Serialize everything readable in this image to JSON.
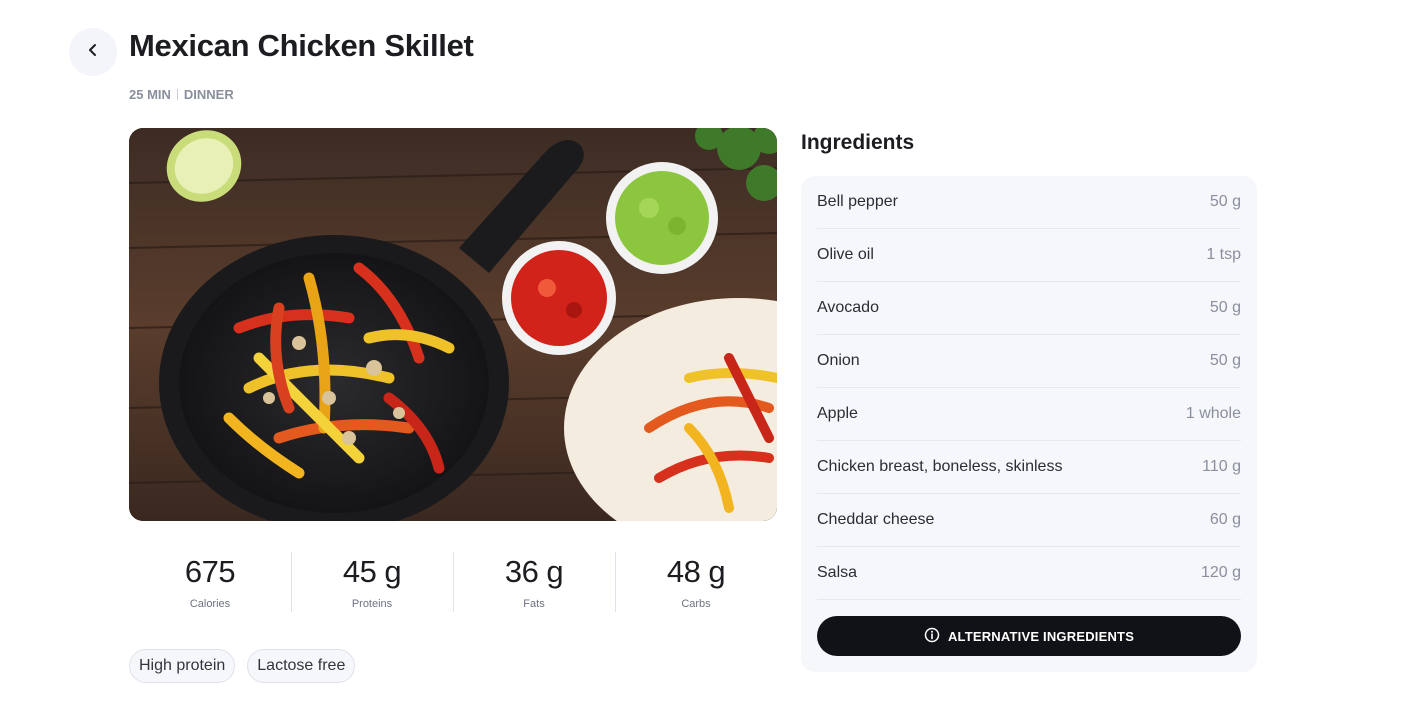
{
  "recipe": {
    "title": "Mexican Chicken Skillet",
    "duration": "25 MIN",
    "meal_type": "DINNER"
  },
  "nutrition": [
    {
      "value": "675",
      "label": "Calories"
    },
    {
      "value": "45 g",
      "label": "Proteins"
    },
    {
      "value": "36 g",
      "label": "Fats"
    },
    {
      "value": "48 g",
      "label": "Carbs"
    }
  ],
  "tags": [
    "High protein",
    "Lactose free"
  ],
  "ingredients": {
    "heading": "Ingredients",
    "items": [
      {
        "name": "Bell pepper",
        "qty": "50 g"
      },
      {
        "name": "Olive oil",
        "qty": "1 tsp"
      },
      {
        "name": "Avocado",
        "qty": "50 g"
      },
      {
        "name": "Onion",
        "qty": "50 g"
      },
      {
        "name": "Apple",
        "qty": "1 whole"
      },
      {
        "name": "Chicken breast, boneless, skinless",
        "qty": "110 g"
      },
      {
        "name": "Cheddar cheese",
        "qty": "60 g"
      },
      {
        "name": "Salsa",
        "qty": "120 g"
      }
    ],
    "alt_button_label": "ALTERNATIVE INGREDIENTS"
  },
  "icons": {
    "back": "chevron-left-icon",
    "info": "info-icon"
  },
  "colors": {
    "primary_button": "#111217",
    "card_background": "#f6f7fb",
    "muted_text": "#8a8f9e"
  }
}
